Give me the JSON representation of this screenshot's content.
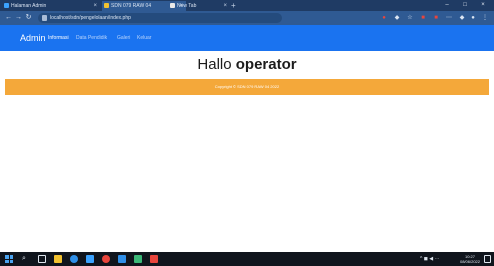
{
  "browser": {
    "tabs": [
      {
        "title": "Halaman Admin",
        "active": false,
        "color": "#3ba3ff"
      },
      {
        "title": "SDN 079 RAW 04",
        "active": true,
        "color": "#f2c230"
      },
      {
        "title": "New Tab",
        "active": false,
        "color": "#e8e8e8"
      }
    ],
    "new_tab_label": "+",
    "window_controls": {
      "minimize": "–",
      "maximize": "□",
      "close": "×"
    },
    "nav": {
      "back": "←",
      "forward": "→",
      "reload": "↻"
    },
    "url": "localhost/sdn/pengelolaan/index.php"
  },
  "navbar": {
    "brand": "Admin",
    "links": [
      {
        "label": "Informasi",
        "active": true
      },
      {
        "label": "Data Pendidik",
        "active": false
      },
      {
        "label": "Galeri",
        "active": false
      },
      {
        "label": "Keluar",
        "active": false
      }
    ]
  },
  "main": {
    "greeting_prefix": "Hallo",
    "greeting_name": "operator"
  },
  "footer": {
    "text": "Copyright © SDN 079 RAW 04 2022"
  },
  "taskbar": {
    "search_icon": "⌕",
    "apps": [
      {
        "name": "task-view-icon",
        "color": "#dfe6ef"
      },
      {
        "name": "explorer-icon",
        "color": "#f2c230"
      },
      {
        "name": "edge-icon",
        "color": "#2f8fe8"
      },
      {
        "name": "photos-icon",
        "color": "#3ba3ff"
      },
      {
        "name": "chrome-icon",
        "color": "#e8453c"
      },
      {
        "name": "vscode-icon",
        "color": "#2f8fe8"
      },
      {
        "name": "app-green-icon",
        "color": "#3cb878"
      },
      {
        "name": "app-red-icon",
        "color": "#e8453c"
      }
    ],
    "tray": "^ ◼ ◀ ⋯",
    "time": "10:27",
    "date": "08/06/2022"
  },
  "colors": {
    "navbar": "#1a73f0",
    "footer": "#f4a83a",
    "taskbar": "#10151d",
    "tabstrip": "#1f3b64"
  }
}
